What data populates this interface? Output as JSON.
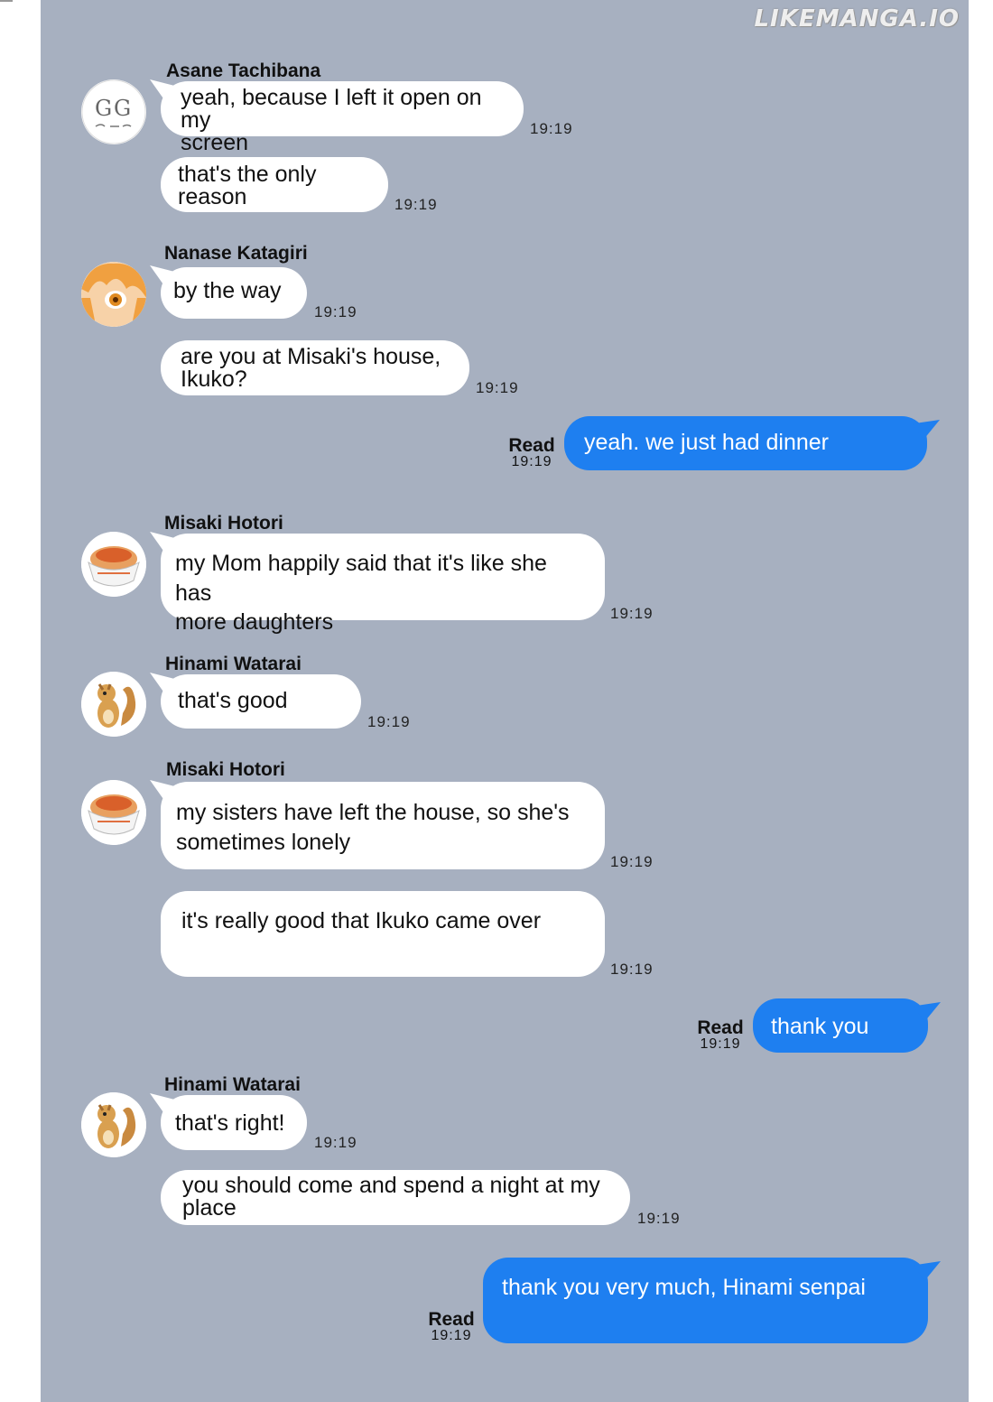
{
  "watermark": "LIKEMANGA.IO",
  "messages": [
    {
      "sender": "Asane Tachibana",
      "avatar": "gg-avatar",
      "text": "yeah, because I left it open on my screen",
      "lines": [
        "yeah, because I left it open on my",
        "screen"
      ],
      "time": "19:19"
    },
    {
      "text": "that's the only reason",
      "lines": [
        "that's the only",
        "reason"
      ],
      "time": "19:19"
    },
    {
      "sender": "Nanase Katagiri",
      "avatar": "anime-girl-avatar",
      "text": "by the way",
      "time": "19:19"
    },
    {
      "text": "are you at Misaki's house, Ikuko?",
      "lines": [
        "are you at Misaki's house,",
        "Ikuko?"
      ],
      "time": "19:19"
    },
    {
      "outgoing": true,
      "text": "yeah. we just had dinner",
      "status": "Read",
      "time": "19:19"
    },
    {
      "sender": "Misaki Hotori",
      "avatar": "food-bowl-avatar",
      "text": "my Mom happily said that it's like she has more daughters",
      "lines": [
        "my Mom happily said that it's like she has",
        "more daughters"
      ],
      "time": "19:19"
    },
    {
      "sender": "Hinami Watarai",
      "avatar": "squirrel-avatar",
      "text": "that's good",
      "time": "19:19"
    },
    {
      "sender": "Misaki Hotori",
      "avatar": "food-bowl-avatar",
      "text": "my sisters have left the house, so she's sometimes lonely",
      "lines": [
        "my sisters have left the house, so she's",
        "sometimes lonely"
      ],
      "time": "19:19"
    },
    {
      "text": "it's really good that Ikuko came over",
      "time": "19:19"
    },
    {
      "outgoing": true,
      "text": "thank you",
      "status": "Read",
      "time": "19:19"
    },
    {
      "sender": "Hinami Watarai",
      "avatar": "squirrel-avatar",
      "text": "that's right!",
      "time": "19:19"
    },
    {
      "text": "you should come and spend a night at my place",
      "lines": [
        "you should come and spend a night at my",
        "place"
      ],
      "time": "19:19"
    },
    {
      "outgoing": true,
      "text": "thank you very much, Hinami senpai",
      "status": "Read",
      "time": "19:19"
    }
  ]
}
